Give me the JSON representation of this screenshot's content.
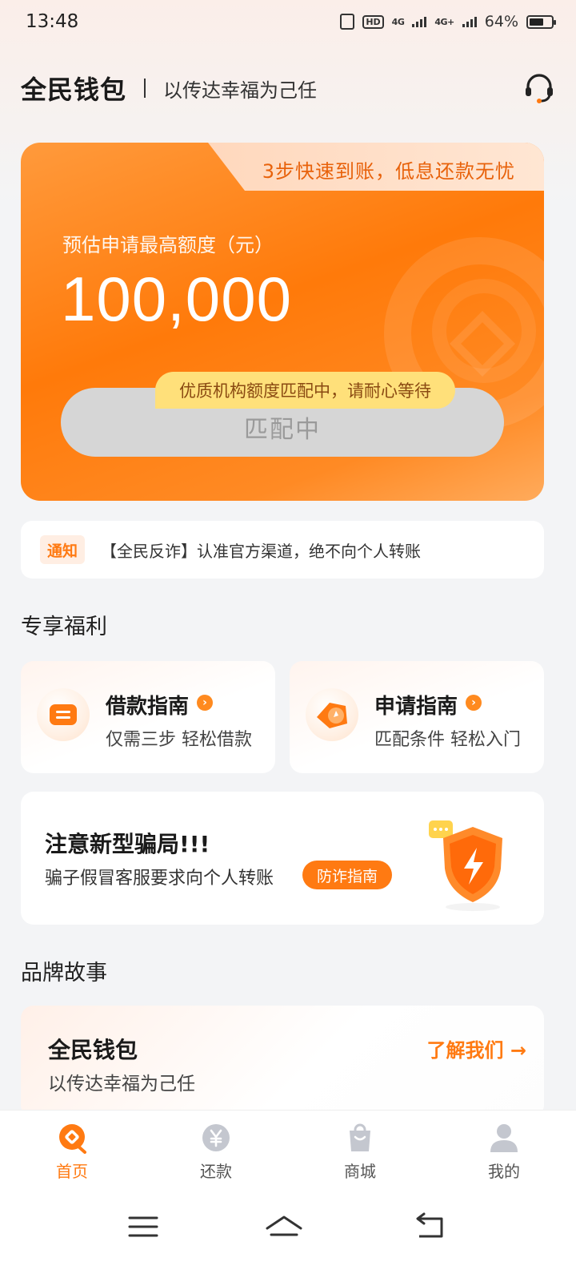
{
  "status_bar": {
    "time": "13:48",
    "battery_percent": "64%",
    "battery_level": 0.64,
    "network_1": "4G",
    "network_2": "4G+",
    "hd_label": "HD"
  },
  "header": {
    "brand": "全民钱包",
    "slogan": "以传达幸福为己任",
    "icon": "customer-service-icon"
  },
  "quota_card": {
    "tab_text": "3步快速到账，低息还款无忧",
    "label": "预估申请最高额度（元）",
    "amount": "100,000",
    "button_label": "匹配中",
    "tip": "优质机构额度匹配中，请耐心等待",
    "accent_color": "#ff7a0a"
  },
  "notice": {
    "tag": "通知",
    "text": "【全民反诈】认准官方渠道，绝不向个人转账"
  },
  "benefits": {
    "title": "专享福利",
    "cards": [
      {
        "title": "借款指南",
        "subtitle": "仅需三步 轻松借款",
        "icon": "loan-guide-icon"
      },
      {
        "title": "申请指南",
        "subtitle": "匹配条件 轻松入门",
        "icon": "apply-guide-icon"
      }
    ]
  },
  "fraud_banner": {
    "title": "注意新型骗局!!!",
    "subtitle": "骗子假冒客服要求向个人转账",
    "button_label": "防诈指南",
    "icon": "shield-lightning-icon"
  },
  "brand_story": {
    "title": "品牌故事",
    "card_title": "全民钱包",
    "card_subtitle": "以传达幸福为己任",
    "link_label": "了解我们 →"
  },
  "tabbar": {
    "items": [
      {
        "label": "首页",
        "icon": "home-icon",
        "active": true
      },
      {
        "label": "还款",
        "icon": "yuan-icon",
        "active": false
      },
      {
        "label": "商城",
        "icon": "shopping-bag-icon",
        "active": false
      },
      {
        "label": "我的",
        "icon": "user-icon",
        "active": false
      }
    ]
  },
  "system_nav": {
    "icons": [
      "menu-icon",
      "home-outline-icon",
      "back-icon"
    ]
  }
}
